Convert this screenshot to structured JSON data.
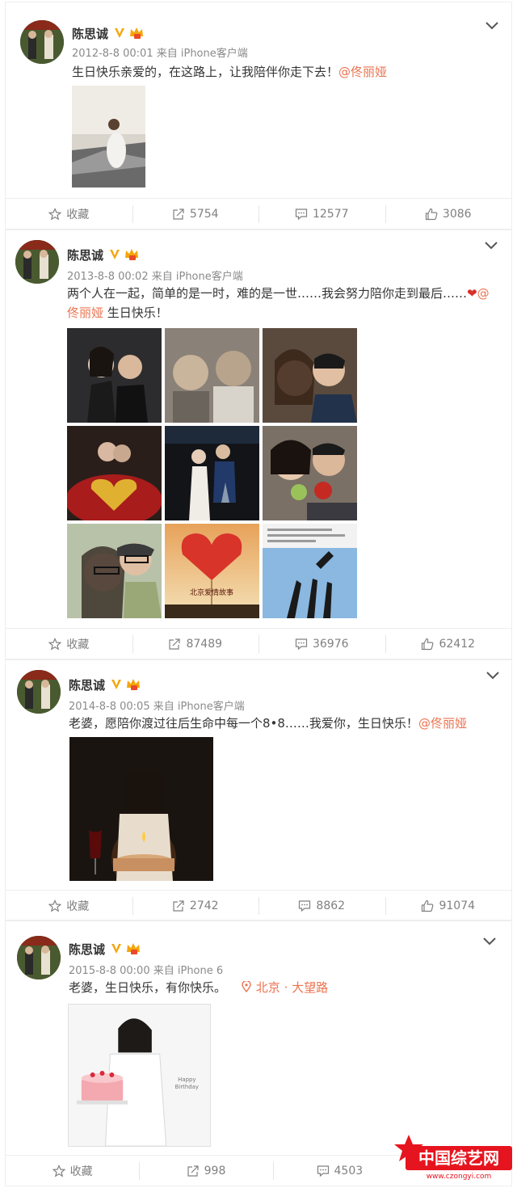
{
  "posts": [
    {
      "username": "陈思诚",
      "meta": "2012-8-8 00:01 来自 iPhone客户端",
      "text": "生日快乐亲爱的，在这路上，让我陪伴你走下去！",
      "mention": "@佟丽娅",
      "actions": {
        "favorite": "收藏",
        "repost": "5754",
        "comment": "12577",
        "like": "3086"
      }
    },
    {
      "username": "陈思诚",
      "meta": "2013-8-8 00:02 来自 iPhone客户端",
      "text": "两个人在一起，简单的是一时，难的是一世……我会努力陪你走到最后……",
      "mention": "@佟丽娅",
      "text_after": " 生日快乐！",
      "actions": {
        "favorite": "收藏",
        "repost": "87489",
        "comment": "36976",
        "like": "62412"
      }
    },
    {
      "username": "陈思诚",
      "meta": "2014-8-8 00:05 来自 iPhone客户端",
      "text": "老婆，愿陪你渡过往后生命中每一个8•8……我爱你，生日快乐！",
      "mention": "@佟丽娅",
      "actions": {
        "favorite": "收藏",
        "repost": "2742",
        "comment": "8862",
        "like": "91074"
      }
    },
    {
      "username": "陈思诚",
      "meta": "2015-8-8 00:00 来自 iPhone 6",
      "text": "老婆，生日快乐，有你快乐。",
      "location": "北京 · 大望路",
      "photo_text": "Happy Birthday",
      "actions": {
        "favorite": "收藏",
        "repost": "998",
        "comment": "4503"
      }
    }
  ],
  "poster_text": "北京爱情故事",
  "watermark": {
    "brand": "中国综艺网",
    "url": "www.czongyi.com"
  },
  "colors": {
    "accent": "#eb7350",
    "meta": "#8a8a8a",
    "verified": "#f4a60b"
  }
}
